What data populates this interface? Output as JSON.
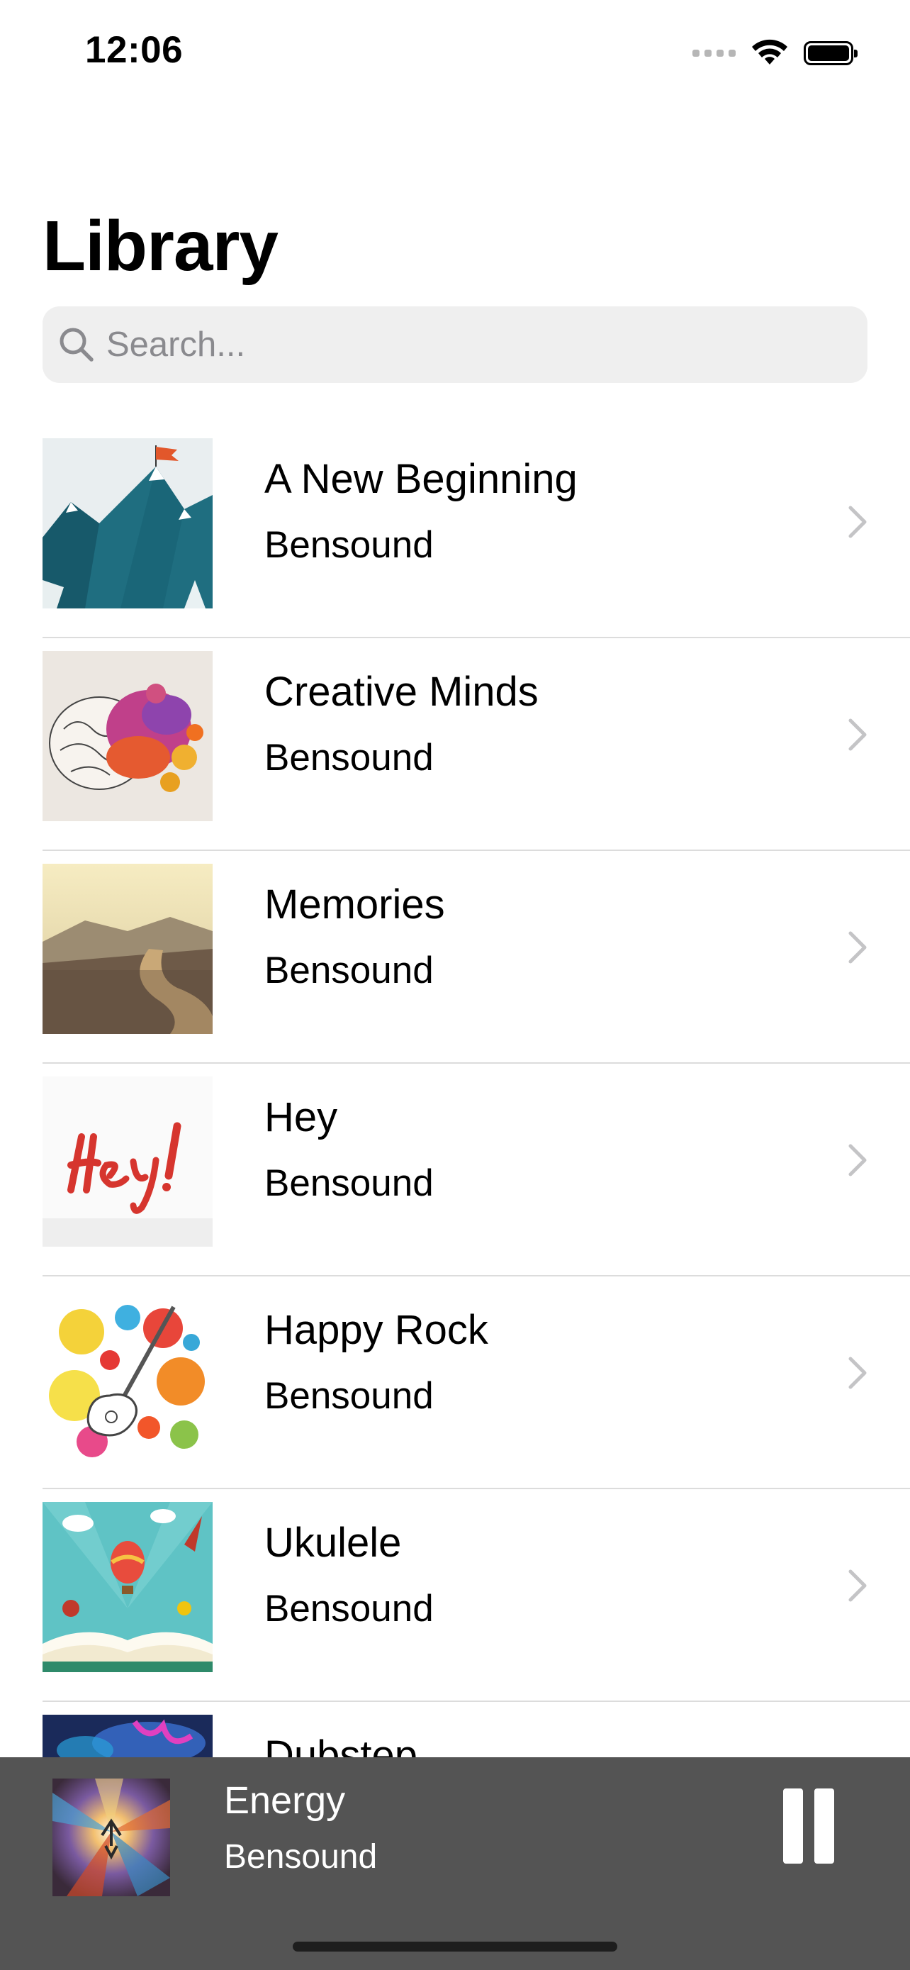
{
  "status_bar": {
    "time": "12:06",
    "icons": [
      "signal-dots-icon",
      "wifi-icon",
      "battery-icon"
    ]
  },
  "header": {
    "title": "Library"
  },
  "search": {
    "placeholder": "Search...",
    "value": "",
    "icon": "search-icon"
  },
  "songs": [
    {
      "title": "A New Beginning",
      "artist": "Bensound",
      "artwork": "mountain-flag-artwork"
    },
    {
      "title": "Creative Minds",
      "artist": "Bensound",
      "artwork": "colorful-brain-artwork"
    },
    {
      "title": "Memories",
      "artist": "Bensound",
      "artwork": "road-landscape-artwork"
    },
    {
      "title": "Hey",
      "artist": "Bensound",
      "artwork": "hey-lettering-artwork"
    },
    {
      "title": "Happy Rock",
      "artist": "Bensound",
      "artwork": "guitar-paint-splash-artwork"
    },
    {
      "title": "Ukulele",
      "artist": "Bensound",
      "artwork": "storybook-balloon-artwork"
    },
    {
      "title": "Dubstep",
      "artist": "",
      "artwork": "neon-figure-artwork"
    }
  ],
  "now_playing": {
    "title": "Energy",
    "artist": "Bensound",
    "artwork": "energy-burst-artwork",
    "state_icon": "pause-icon"
  },
  "colors": {
    "background": "#ffffff",
    "search_fill": "#efefef",
    "placeholder": "#8a8a8e",
    "divider": "#dcdcdc",
    "chevron": "#c4c4c6",
    "mini_player": "#545454"
  }
}
